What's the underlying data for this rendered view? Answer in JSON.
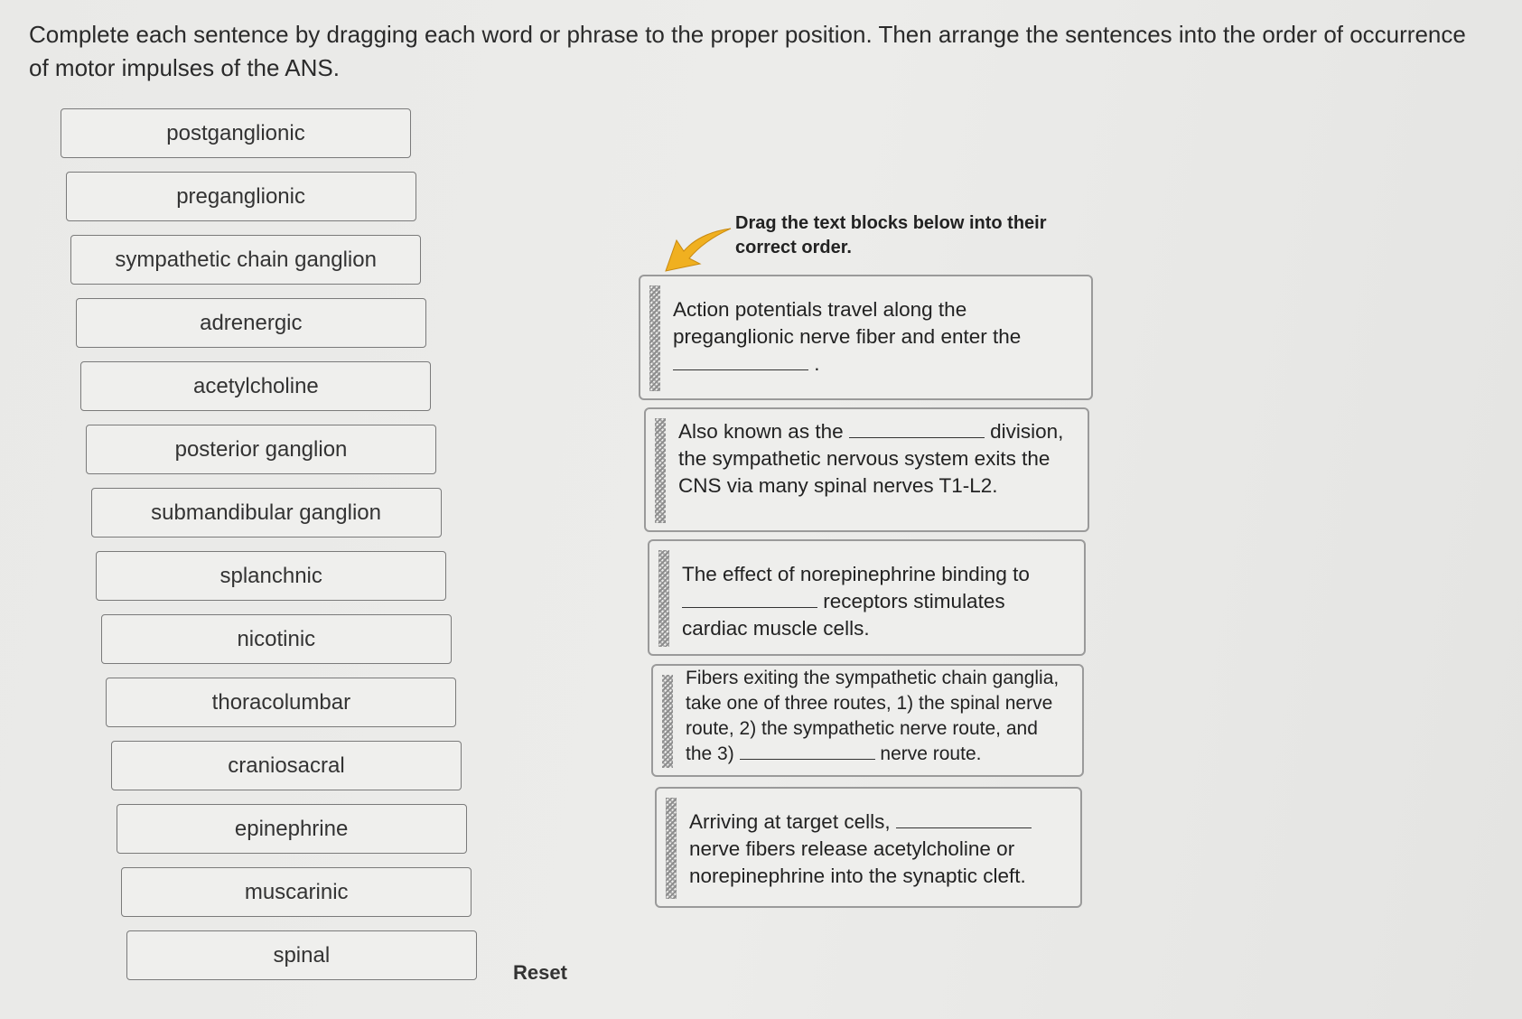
{
  "instructions": "Complete each sentence by dragging each word or phrase to the proper position. Then arrange the sentences into the order of occurrence of motor impulses of the ANS.",
  "word_bank": [
    "postganglionic",
    "preganglionic",
    "sympathetic chain ganglion",
    "adrenergic",
    "acetylcholine",
    "posterior ganglion",
    "submandibular ganglion",
    "splanchnic",
    "nicotinic",
    "thoracolumbar",
    "craniosacral",
    "epinephrine",
    "muscarinic",
    "spinal"
  ],
  "reset_label": "Reset",
  "hint": {
    "text": "Drag the text blocks below into their correct order.",
    "arrow_color": "#f0b020",
    "icon": "arrow-down-left-icon"
  },
  "sentences": [
    {
      "before": "Action potentials travel along the preganglionic nerve fiber and enter the",
      "after": "."
    },
    {
      "before": "Also known as the",
      "after": "division, the sympathetic nervous system exits the CNS via many spinal nerves T1-L2."
    },
    {
      "before": "The effect of norepinephrine binding to",
      "after": "receptors stimulates cardiac muscle cells."
    },
    {
      "before": "Fibers exiting the sympathetic chain ganglia, take one of three routes, 1) the spinal nerve route, 2) the sympathetic nerve route, and the 3)",
      "after": "nerve route."
    },
    {
      "before": "Arriving at target cells,",
      "after": "nerve fibers release acetylcholine or norepinephrine into the synaptic cleft."
    }
  ]
}
